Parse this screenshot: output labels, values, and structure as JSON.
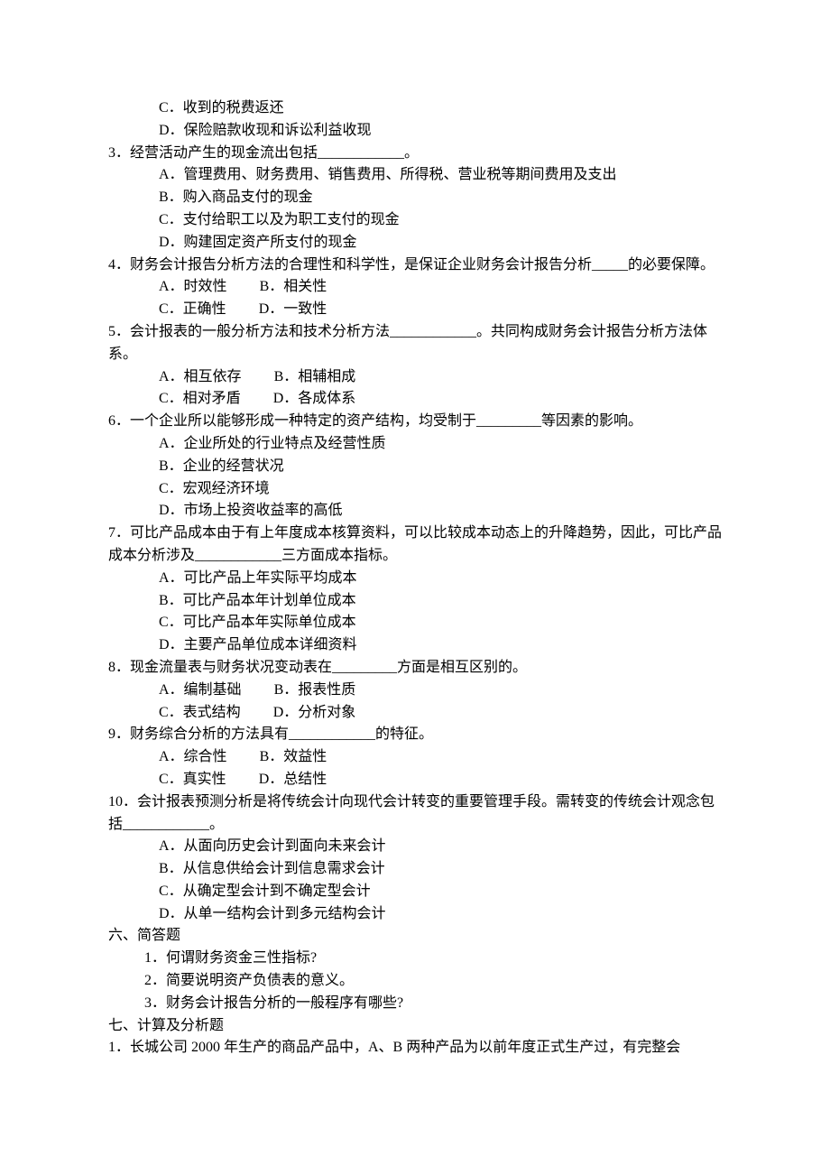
{
  "q_cont_optC": "C．收到的税费返还",
  "q_cont_optD": "D．保险赔款收现和诉讼利益收现",
  "q3": {
    "stem": "3．经营活动产生的现金流出包括____________。",
    "A": "A．管理费用、财务费用、销售费用、所得税、营业税等期间费用及支出",
    "B": "B．购入商品支付的现金",
    "C": "C．支付给职工以及为职工支付的现金",
    "D": "D．购建固定资产所支付的现金"
  },
  "q4": {
    "stem": "4．财务会计报告分析方法的合理性和科学性，是保证企业财务会计报告分析_____的必要保障。",
    "A": "A．时效性",
    "B": "B．相关性",
    "C": "C．正确性",
    "D": "D．一致性"
  },
  "q5": {
    "stem": "5．会计报表的一般分析方法和技术分析方法____________。共同构成财务会计报告分析方法体系。",
    "A": "A．相互依存",
    "B": "B．相辅相成",
    "C": "C．相对矛盾",
    "D": "D．各成体系"
  },
  "q6": {
    "stem": "6．一个企业所以能够形成一种特定的资产结构，均受制于_________等因素的影响。",
    "A": "A．企业所处的行业特点及经营性质",
    "B": "B．企业的经营状况",
    "C": "C．宏观经济环境",
    "D": "D．市场上投资收益率的高低"
  },
  "q7": {
    "stem": "7．可比产品成本由于有上年度成本核算资料，可以比较成本动态上的升降趋势，因此，可比产品成本分析涉及____________三方面成本指标。",
    "A": "A．可比产品上年实际平均成本",
    "B": "B．可比产品本年计划单位成本",
    "C": "C．可比产品本年实际单位成本",
    "D": "D．主要产品单位成本详细资料"
  },
  "q8": {
    "stem": "8．现金流量表与财务状况变动表在_________方面是相互区别的。",
    "A": "A．编制基础",
    "B": "B．报表性质",
    "C": "C．表式结构",
    "D": "D．分析对象"
  },
  "q9": {
    "stem": "9．财务综合分析的方法具有____________的特征。",
    "A": "A．综合性",
    "B": "B．效益性",
    "C": "C．真实性",
    "D": "D．总结性"
  },
  "q10": {
    "stem": "10．会计报表预测分析是将传统会计向现代会计转变的重要管理手段。需转变的传统会计观念包括____________。",
    "A": "A．从面向历史会计到面向未来会计",
    "B": "B．从信息供给会计到信息需求会计",
    "C": "C．从确定型会计到不确定型会计",
    "D": "D．从单一结构会计到多元结构会计"
  },
  "sec6": {
    "heading": "六、简答题",
    "i1": "1．何谓财务资金三性指标?",
    "i2": "2．简要说明资产负债表的意义。",
    "i3": "3．财务会计报告分析的一般程序有哪些?"
  },
  "sec7": {
    "heading": "七、计算及分析题",
    "i1": "1．长城公司 2000 年生产的商品产品中，A、B 两种产品为以前年度正式生产过，有完整会"
  }
}
